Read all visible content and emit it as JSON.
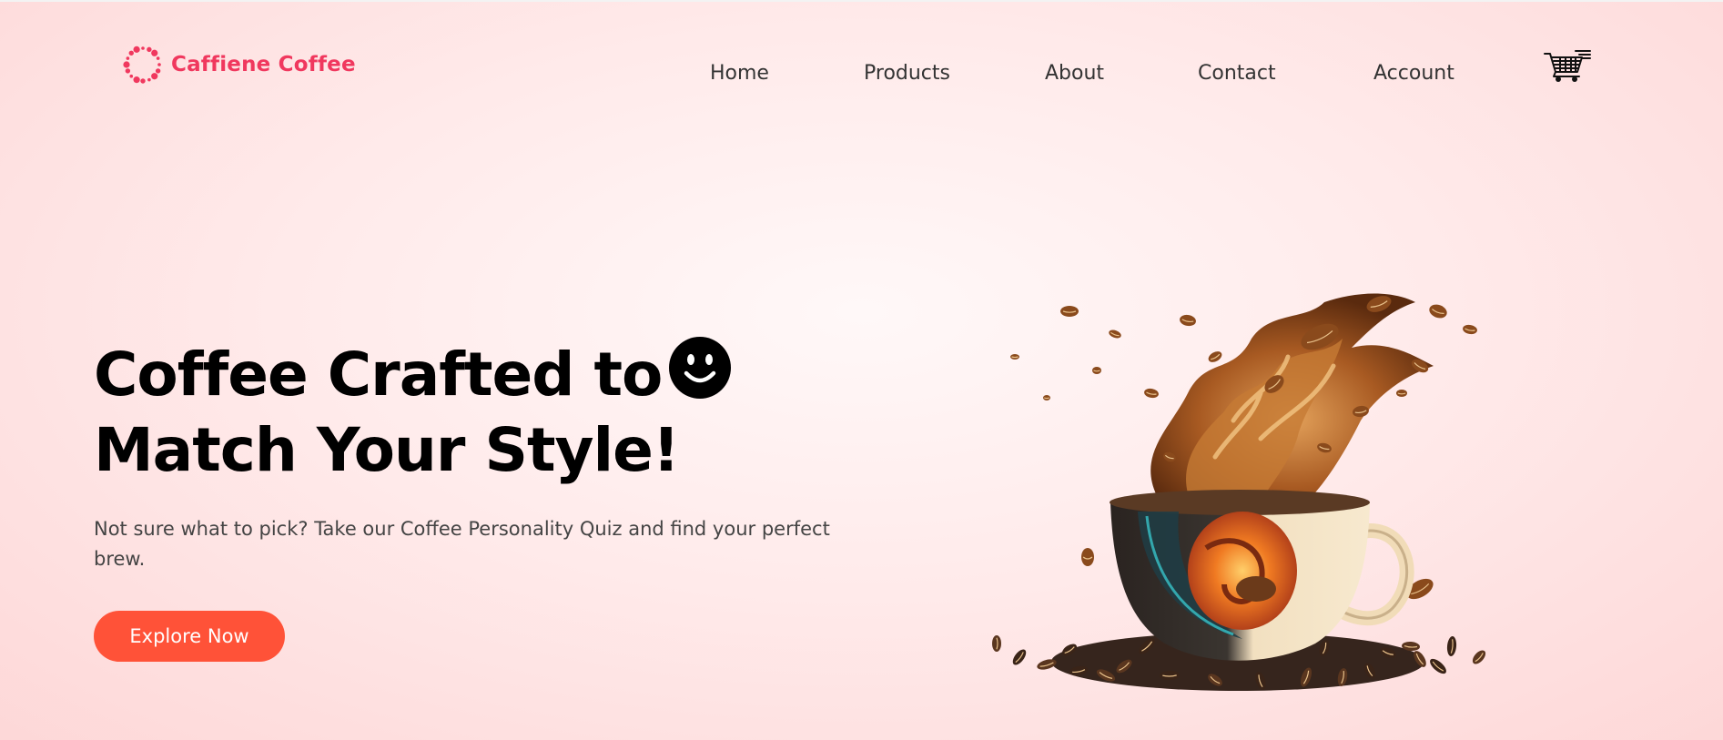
{
  "brand": {
    "name": "Caffiene Coffee",
    "color": "#f0385e"
  },
  "nav": {
    "items": [
      {
        "label": "Home"
      },
      {
        "label": "Products"
      },
      {
        "label": "About"
      },
      {
        "label": "Contact"
      },
      {
        "label": "Account"
      }
    ],
    "cart_icon": "shopping-cart-icon"
  },
  "hero": {
    "headline_line1": "Coffee Crafted to",
    "headline_icon": "smiley-face-icon",
    "headline_line2": "Match Your Style!",
    "description": "Not sure what to pick? Take our Coffee Personality Quiz and find your perfect brew.",
    "cta_label": "Explore Now",
    "cta_color": "#ff5238",
    "image": "coffee-cup-splash-illustration"
  }
}
